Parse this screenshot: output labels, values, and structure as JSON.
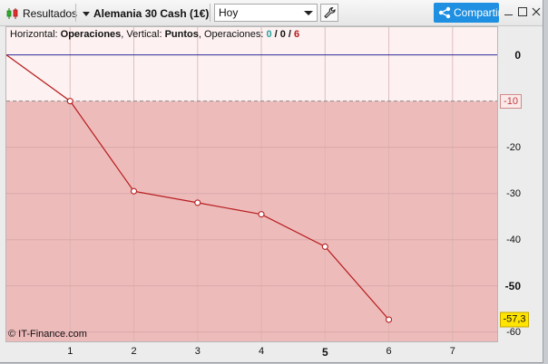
{
  "toolbar": {
    "results_label": "Resultados",
    "instrument_label": "Alemania 30 Cash (1€)",
    "period_value": "Hoy",
    "share_label": "Compartir",
    "icons": [
      "candlestick-icon",
      "dropdown-arrow-icon",
      "wrench-icon",
      "share-icon",
      "minimize-icon",
      "maximize-icon",
      "close-icon"
    ]
  },
  "header": {
    "horizontal_prefix": "Horizontal: ",
    "horizontal_value": "Operaciones",
    "vertical_prefix": ", Vertical: ",
    "vertical_value": "Puntos",
    "ops_prefix": ", Operaciones: ",
    "ops_win": "0",
    "ops_sep1": " / ",
    "ops_even": "0",
    "ops_sep2": " / ",
    "ops_loss": "6"
  },
  "credit": "© IT-Finance.com",
  "colors": {
    "profit_zone": "#fdf1f1",
    "loss_zone": "#eebbbb",
    "line": "#b61c1c",
    "zero_line": "#2b2b9a",
    "win": "#2aa3a0",
    "loss": "#b61c1c",
    "badge": "#ffe400"
  },
  "chart_data": {
    "type": "line",
    "x": [
      0,
      1,
      2,
      3,
      4,
      5,
      6
    ],
    "values": [
      0,
      -10,
      -29.5,
      -32,
      -34.5,
      -41.5,
      -57.3
    ],
    "xlabel": "Operaciones",
    "ylabel": "Puntos",
    "xlim": [
      0,
      7.7
    ],
    "ylim": [
      -62,
      6
    ],
    "x_ticks": [
      "1",
      "2",
      "3",
      "4",
      "5",
      "6",
      "7"
    ],
    "x_tick_bold": "5",
    "y_ticks": [
      "0",
      "-20",
      "-30",
      "-40",
      "-50",
      "-60"
    ],
    "y_tick_bold": [
      "0",
      "-50"
    ],
    "reference_level": "-10",
    "last_value_label": "-57,3",
    "grid": true
  }
}
